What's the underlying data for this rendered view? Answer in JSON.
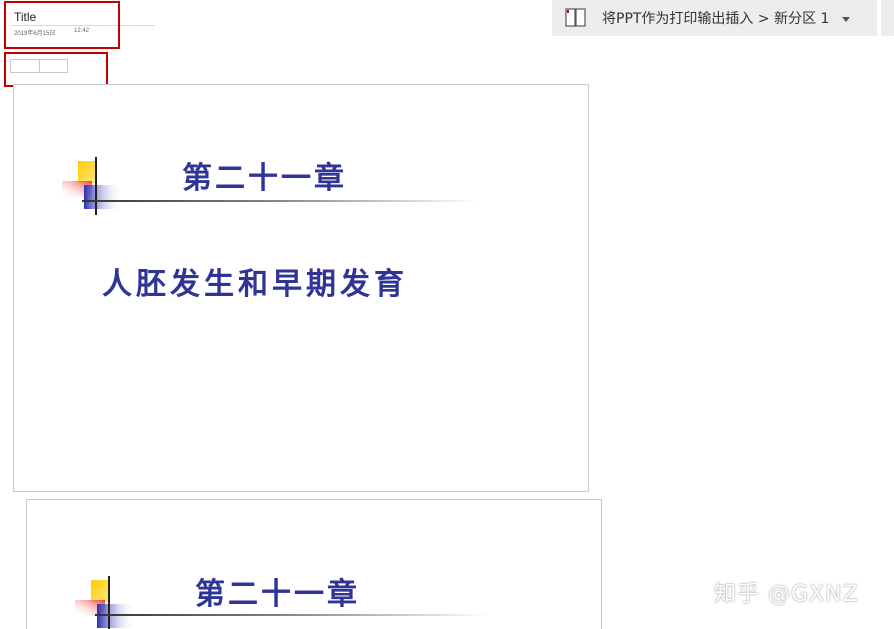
{
  "page": {
    "title": "Title",
    "date": "2019年6月15日",
    "time": "12:42"
  },
  "breadcrumb": {
    "text": "将PPT作为打印输出插入 > 新分区 1",
    "icon": "notebook-icon",
    "dropdown_icon": "chevron-down-icon"
  },
  "slides": [
    {
      "chapter_title": "第二十一章",
      "subtitle": "人胚发生和早期发育"
    },
    {
      "chapter_title": "第二十一章"
    }
  ],
  "watermark": "知乎 @GXNZ",
  "colors": {
    "slide_text": "#2f3596",
    "annotation_red": "#c00000",
    "toolbar_bg": "#ededed",
    "logo_yellow": "#ffcc00",
    "logo_red": "#e8403a",
    "logo_blue": "#2b2fb3"
  }
}
